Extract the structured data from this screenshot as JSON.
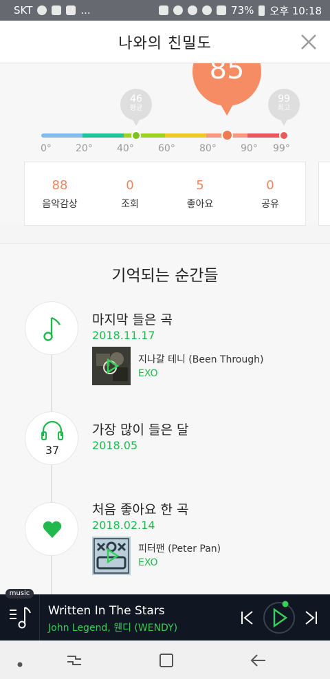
{
  "status_bar": {
    "carrier": "SKT",
    "more": "...",
    "battery": "73%",
    "time": "오후 10:18"
  },
  "header": {
    "title": "나와의 친밀도"
  },
  "gauge": {
    "score": "85",
    "average": {
      "value": "46",
      "label": "평균"
    },
    "max": {
      "value": "99",
      "label": "최고"
    },
    "ticks": [
      "0°",
      "20°",
      "40°",
      "60°",
      "80°",
      "90°",
      "99°"
    ],
    "colors": [
      "#7fbef2",
      "#22c39a",
      "#9ed222",
      "#f2c629",
      "#f69b79",
      "#e55b5b"
    ]
  },
  "stats": [
    {
      "value": "88",
      "label": "음악감상"
    },
    {
      "value": "0",
      "label": "조회"
    },
    {
      "value": "5",
      "label": "좋아요"
    },
    {
      "value": "0",
      "label": "공유"
    }
  ],
  "memories": {
    "title": "기억되는 순간들",
    "items": [
      {
        "icon": "music-note-icon",
        "title": "마지막 들은 곡",
        "date": "2018.11.17",
        "song": {
          "title": "지나갈 테니 (Been Through)",
          "artist": "EXO"
        }
      },
      {
        "icon": "headphones-icon",
        "count": "37",
        "title": "가장 많이 들은 달",
        "date": "2018.05"
      },
      {
        "icon": "heart-icon",
        "title": "처음 좋아요 한 곡",
        "date": "2018.02.14",
        "song": {
          "title": "피터팬 (Peter Pan)",
          "artist": "EXO"
        }
      }
    ]
  },
  "player": {
    "badge": "music",
    "title": "Written In The Stars",
    "artist": "John Legend, 웬디 (WENDY)"
  },
  "accent": "#21b84e",
  "score_color": "#f58c63"
}
